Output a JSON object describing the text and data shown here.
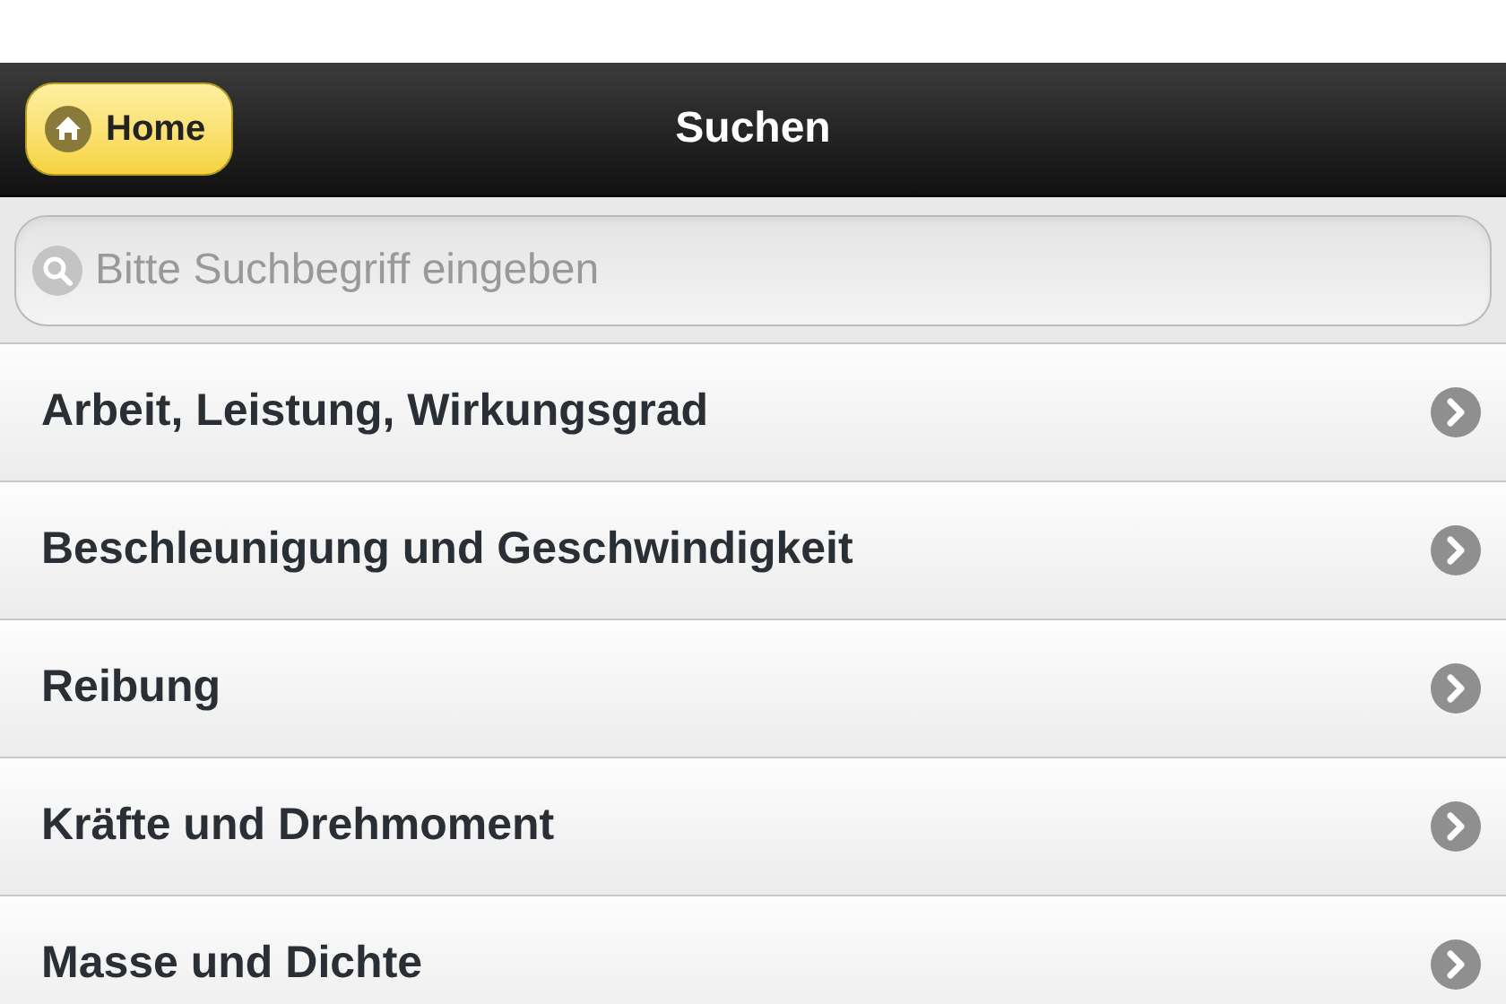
{
  "header": {
    "title": "Suchen",
    "home_button": "Home"
  },
  "search": {
    "placeholder": "Bitte Suchbegriff eingeben"
  },
  "items": [
    {
      "label": "Arbeit, Leistung, Wirkungsgrad"
    },
    {
      "label": "Beschleunigung und Geschwindigkeit"
    },
    {
      "label": "Reibung"
    },
    {
      "label": "Kräfte und Drehmoment"
    },
    {
      "label": "Masse und Dichte"
    }
  ]
}
